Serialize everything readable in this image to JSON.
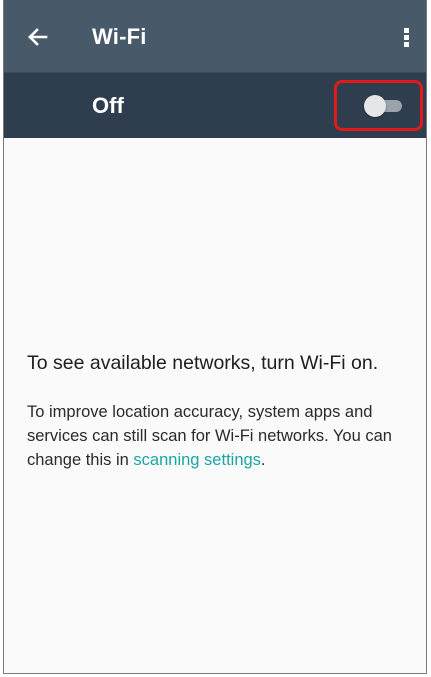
{
  "app_bar": {
    "title": "Wi-Fi",
    "back_icon": "arrow-left-icon",
    "more_icon": "more-vert-icon",
    "background": "#48596a"
  },
  "master_switch": {
    "label": "Off",
    "state": "off",
    "background": "#2e3e4e",
    "highlight_color": "#e01a1a"
  },
  "empty_state": {
    "title": "To see available networks, turn Wi-Fi on.",
    "body_line_1": "To improve location accuracy, system apps and services can still scan for Wi-Fi networks. You can change this in",
    "link_text": "scanning settings",
    "body_end": ".",
    "link_color": "#1aa5a5"
  }
}
